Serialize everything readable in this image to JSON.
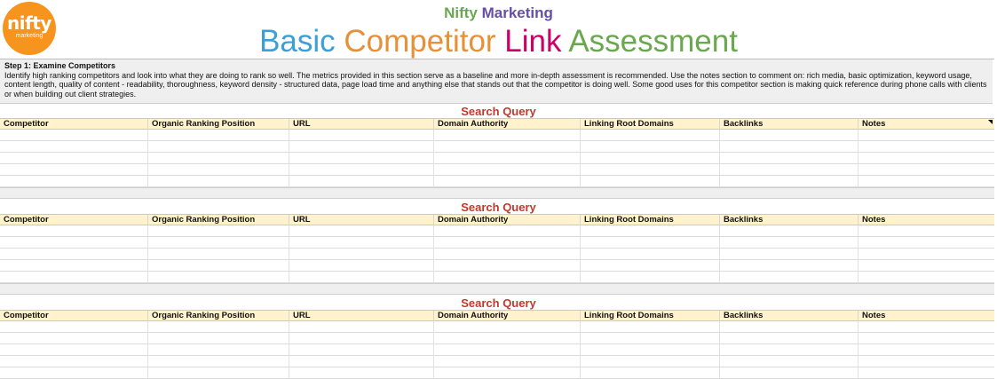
{
  "brand": {
    "word1": "Nifty",
    "word2": "Marketing"
  },
  "logo": {
    "text": "nifty",
    "tagline": "marketing"
  },
  "title": {
    "w1": "Basic",
    "w2": "Competitor",
    "w3": "Link",
    "w4": "Assessment"
  },
  "intro": {
    "heading": "Step 1: Examine Competitors",
    "body": "Identify high ranking competitors and look into what they are doing to rank so well. The metrics provided in this section serve as a baseline and more in-depth assessment is recommended. Use the notes section to comment on: rich media, basic optimization, keyword usage, content length, quality of content - readability, thoroughness, keyword density - structured data, page load time and anything else that stands out that the competitor is doing well. Some good uses for this competitor section is making quick reference during phone calls with clients or when building out client strategies."
  },
  "blocks": [
    {
      "label": "Search Query"
    },
    {
      "label": "Search Query"
    },
    {
      "label": "Search Query"
    }
  ],
  "columns": [
    "Competitor",
    "Organic Ranking Position",
    "URL",
    "Domain Authority",
    "Linking Root Domains",
    "Backlinks",
    "Notes"
  ],
  "colors": {
    "header_fill": "#fff2cc",
    "query_text": "#c0392b",
    "logo_orange": "#f7941d"
  }
}
